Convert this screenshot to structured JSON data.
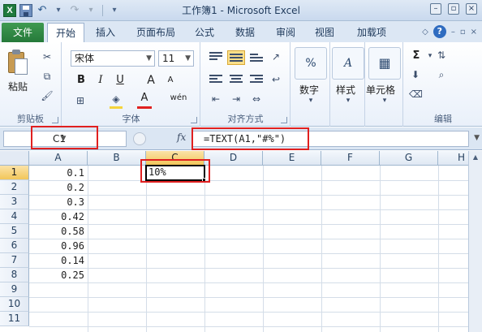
{
  "window": {
    "title": "工作簿1 - Microsoft Excel",
    "qat_icons": [
      "excel-logo-icon",
      "save-icon",
      "undo-icon",
      "redo-icon",
      "customize-qat-icon"
    ],
    "controls": [
      "minimize",
      "restore",
      "close"
    ]
  },
  "ribbon": {
    "file_tab": "文件",
    "tabs": [
      {
        "label": "开始",
        "active": true
      },
      {
        "label": "插入",
        "active": false
      },
      {
        "label": "页面布局",
        "active": false
      },
      {
        "label": "公式",
        "active": false
      },
      {
        "label": "数据",
        "active": false
      },
      {
        "label": "审阅",
        "active": false
      },
      {
        "label": "视图",
        "active": false
      },
      {
        "label": "加载项",
        "active": false
      }
    ],
    "groups": {
      "clipboard": {
        "label": "剪贴板",
        "paste": "粘贴"
      },
      "font": {
        "label": "字体",
        "font_name": "宋体",
        "font_size": "11",
        "bold": "B",
        "italic": "I",
        "underline": "U",
        "grow": "A",
        "shrink": "A",
        "phonetic": "wén",
        "font_color": "#e02020",
        "fill_color": "#f5d33a"
      },
      "alignment": {
        "label": "对齐方式"
      },
      "number": {
        "label": "数字",
        "symbol": "%"
      },
      "styles": {
        "label": "样式",
        "symbol": "A"
      },
      "cells": {
        "label": "单元格"
      },
      "editing": {
        "label": "编辑",
        "sum": "Σ"
      }
    }
  },
  "formula_bar": {
    "name_box": "C1",
    "fx_label": "fx",
    "formula": "=TEXT(A1,\"#%\")"
  },
  "sheet": {
    "columns": [
      "A",
      "B",
      "C",
      "D",
      "E",
      "F",
      "G",
      "H"
    ],
    "selected_column": "C",
    "rows": [
      "1",
      "2",
      "3",
      "4",
      "5",
      "6",
      "7",
      "8",
      "9",
      "10",
      "11"
    ],
    "selected_row": "1",
    "column_a_values": [
      "0.1",
      "0.2",
      "0.3",
      "0.42",
      "0.58",
      "0.96",
      "0.14",
      "0.25"
    ],
    "active_cell": {
      "ref": "C1",
      "value": "10%"
    }
  },
  "highlight_color": "#e02020"
}
